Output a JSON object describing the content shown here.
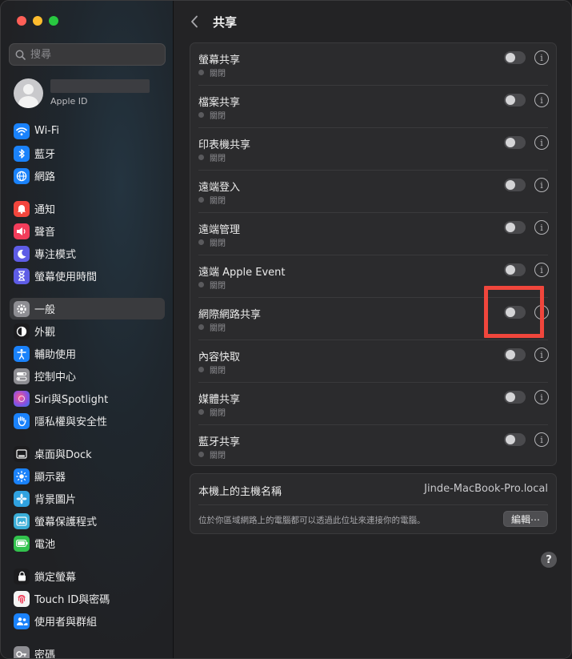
{
  "sidebar": {
    "search_placeholder": "搜尋",
    "account_label": "Apple ID",
    "items": [
      {
        "label": "Wi-Fi",
        "icon": "wifi-icon",
        "color": "#1a82fb"
      },
      {
        "label": "藍牙",
        "icon": "bluetooth-icon",
        "color": "#1a82fb"
      },
      {
        "label": "網路",
        "icon": "globe-icon",
        "color": "#1a82fb"
      },
      {
        "label": "通知",
        "icon": "bell-icon",
        "color": "#f2463d"
      },
      {
        "label": "聲音",
        "icon": "speaker-icon",
        "color": "#f23d5b"
      },
      {
        "label": "專注模式",
        "icon": "moon-icon",
        "color": "#5e5ce6"
      },
      {
        "label": "螢幕使用時間",
        "icon": "hourglass-icon",
        "color": "#5e5ce6"
      },
      {
        "label": "一般",
        "icon": "gear-icon",
        "color": "#8e8e93"
      },
      {
        "label": "外觀",
        "icon": "appearance-icon",
        "color": "#1c1c1e"
      },
      {
        "label": "輔助使用",
        "icon": "accessibility-icon",
        "color": "#1a82fb"
      },
      {
        "label": "控制中心",
        "icon": "control-center-icon",
        "color": "#8e8e93"
      },
      {
        "label": "Siri與Spotlight",
        "icon": "siri-icon",
        "color": "#b04fd6"
      },
      {
        "label": "隱私權與安全性",
        "icon": "hand-icon",
        "color": "#1a82fb"
      },
      {
        "label": "桌面與Dock",
        "icon": "desktop-dock-icon",
        "color": "#1c1c1e"
      },
      {
        "label": "顯示器",
        "icon": "sun-icon",
        "color": "#1a82fb"
      },
      {
        "label": "背景圖片",
        "icon": "wallpaper-icon",
        "color": "#30a2e0"
      },
      {
        "label": "螢幕保護程式",
        "icon": "screensaver-icon",
        "color": "#3aaed8"
      },
      {
        "label": "電池",
        "icon": "battery-icon",
        "color": "#32c24d"
      },
      {
        "label": "鎖定螢幕",
        "icon": "lock-icon",
        "color": "#1c1c1e"
      },
      {
        "label": "Touch ID與密碼",
        "icon": "fingerprint-icon",
        "color": "#f4f4f4"
      },
      {
        "label": "使用者與群組",
        "icon": "users-icon",
        "color": "#1a82fb"
      },
      {
        "label": "密碼",
        "icon": "key-icon",
        "color": "#8e8e93"
      }
    ]
  },
  "header": {
    "title": "共享"
  },
  "sharing": {
    "rows": [
      {
        "title": "螢幕共享",
        "status": "關閉"
      },
      {
        "title": "檔案共享",
        "status": "關閉"
      },
      {
        "title": "印表機共享",
        "status": "關閉"
      },
      {
        "title": "遠端登入",
        "status": "關閉"
      },
      {
        "title": "遠端管理",
        "status": "關閉"
      },
      {
        "title": "遠端 Apple Event",
        "status": "關閉"
      },
      {
        "title": "網際網路共享",
        "status": "關閉"
      },
      {
        "title": "內容快取",
        "status": "關閉"
      },
      {
        "title": "媒體共享",
        "status": "關閉"
      },
      {
        "title": "藍牙共享",
        "status": "關閉"
      }
    ]
  },
  "host": {
    "label": "本機上的主機名稱",
    "value": "Jinde-MacBook-Pro.local",
    "description": "位於你區域網路上的電腦都可以透過此位址來連接你的電腦。",
    "edit_label": "編輯⋯"
  },
  "help_label": "?"
}
